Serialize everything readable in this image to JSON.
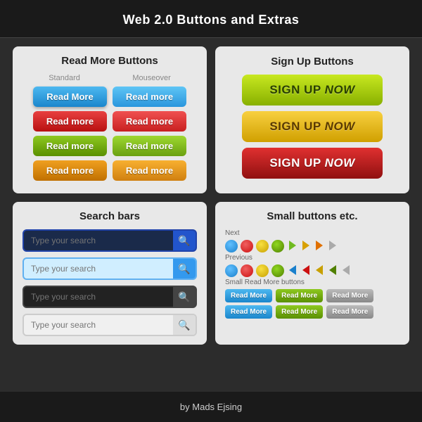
{
  "header": {
    "title": "Web 2.0 Buttons and Extras"
  },
  "read_more_section": {
    "title": "Read More Buttons",
    "standard_label": "Standard",
    "mouseover_label": "Mouseover",
    "buttons": [
      {
        "label": "Read More",
        "style": "blue-std"
      },
      {
        "label": "Read more",
        "style": "blue-hover"
      },
      {
        "label": "Read more",
        "style": "red-std"
      },
      {
        "label": "Read more",
        "style": "red-hover"
      },
      {
        "label": "Read more",
        "style": "green-std"
      },
      {
        "label": "Read more",
        "style": "green-hover"
      },
      {
        "label": "Read more",
        "style": "orange-std"
      },
      {
        "label": "Read more",
        "style": "orange-hover"
      }
    ]
  },
  "signup_section": {
    "title": "Sign Up Buttons",
    "buttons": [
      {
        "text": "SIGN UP NOW",
        "style": "lime"
      },
      {
        "text": "SIGN UP NOW",
        "style": "yellow"
      },
      {
        "text": "SIGN UP NOW",
        "style": "red"
      }
    ]
  },
  "search_section": {
    "title": "Search bars",
    "bars": [
      {
        "placeholder": "Type your search",
        "style": "dark-blue"
      },
      {
        "placeholder": "Type your search",
        "style": "light-blue"
      },
      {
        "placeholder": "Type your search",
        "style": "dark-gray"
      },
      {
        "placeholder": "Type your search",
        "style": "light-gray"
      }
    ]
  },
  "small_section": {
    "title": "Small buttons etc.",
    "next_label": "Next",
    "previous_label": "Previous",
    "small_rm_label": "Small Read More buttons",
    "small_rm_buttons": [
      {
        "label": "Read More",
        "style": "s-blue"
      },
      {
        "label": "Read More",
        "style": "s-green"
      },
      {
        "label": "Read More",
        "style": "s-gray"
      },
      {
        "label": "Read More",
        "style": "s-blue"
      },
      {
        "label": "Read More",
        "style": "s-green"
      },
      {
        "label": "Read More",
        "style": "s-gray"
      }
    ]
  },
  "footer": {
    "credit": "by Mads Ejsing"
  }
}
